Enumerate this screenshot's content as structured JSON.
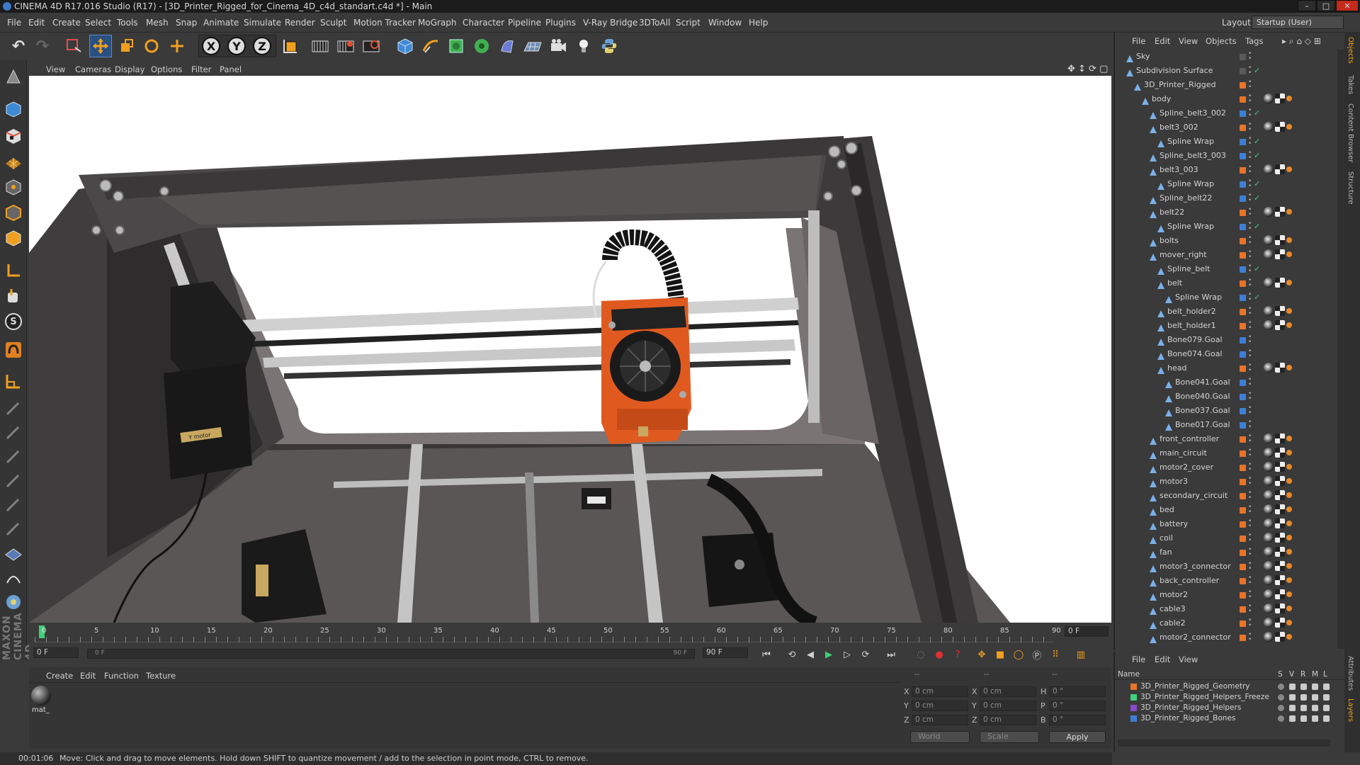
{
  "window": {
    "title": "CINEMA 4D R17.016 Studio (R17) - [3D_Printer_Rigged_for_Cinema_4D_c4d_standart.c4d *] - Main",
    "minimize": "–",
    "maximize": "□",
    "close": "✕"
  },
  "menu": [
    "File",
    "Edit",
    "Create",
    "Select",
    "Tools",
    "Mesh",
    "Snap",
    "Animate",
    "Simulate",
    "Render",
    "Sculpt",
    "Motion Tracker",
    "MoGraph",
    "Character",
    "Pipeline",
    "Plugins",
    "V-Ray Bridge",
    "3DToAll",
    "Script",
    "Window",
    "Help"
  ],
  "layout": {
    "label": "Layout:",
    "value": "Startup (User)"
  },
  "toolbar": {
    "x": "X",
    "y": "Y",
    "z": "Z"
  },
  "lefttools": {
    "s_label": "S"
  },
  "viewport": {
    "menu": [
      "View",
      "Cameras",
      "Display",
      "Options",
      "Filter",
      "Panel"
    ],
    "motor_label": "Y motor"
  },
  "timeline": {
    "ticks": [
      "0",
      "5",
      "10",
      "15",
      "20",
      "25",
      "30",
      "35",
      "40",
      "45",
      "50",
      "55",
      "60",
      "65",
      "70",
      "75",
      "80",
      "85",
      "90"
    ],
    "current_frame": "0 F",
    "start_field": "0 F",
    "range_start": "0 F",
    "range_end": "90 F",
    "end_field": "90 F"
  },
  "materials": {
    "menu": [
      "Create",
      "Edit",
      "Function",
      "Texture"
    ],
    "items": [
      {
        "name": "mat_"
      }
    ]
  },
  "coords": {
    "headers": [
      "--",
      "--",
      "--"
    ],
    "rows": [
      {
        "a": "X",
        "av": "0 cm",
        "b": "X",
        "bv": "0 cm",
        "c": "H",
        "cv": "0 °"
      },
      {
        "a": "Y",
        "av": "0 cm",
        "b": "Y",
        "bv": "0 cm",
        "c": "P",
        "cv": "0 °"
      },
      {
        "a": "Z",
        "av": "0 cm",
        "b": "Z",
        "bv": "0 cm",
        "c": "B",
        "cv": "0 °"
      }
    ],
    "space": "World",
    "mode": "Scale",
    "apply": "Apply"
  },
  "status": {
    "time": "00:01:06",
    "message": "Move: Click and drag to move elements. Hold down SHIFT to quantize movement / add to the selection in point mode, CTRL to remove."
  },
  "objects": {
    "menu": [
      "File",
      "Edit",
      "View",
      "Objects",
      "Tags"
    ],
    "items": [
      {
        "name": "Sky",
        "depth": 0,
        "color": "#5a5a5a",
        "tags": "",
        "check": ""
      },
      {
        "name": "Subdivision Surface",
        "depth": 0,
        "color": "#5a5a5a",
        "tags": "",
        "check": "✓"
      },
      {
        "name": "3D_Printer_Rigged",
        "depth": 1,
        "color": "#e8742a",
        "tags": "",
        "check": ""
      },
      {
        "name": "body",
        "depth": 2,
        "color": "#e8742a",
        "tags": "pco",
        "check": ""
      },
      {
        "name": "Spline_belt3_002",
        "depth": 3,
        "color": "#3d7fd6",
        "tags": "",
        "check": "✓"
      },
      {
        "name": "belt3_002",
        "depth": 3,
        "color": "#e8742a",
        "tags": "pco",
        "check": ""
      },
      {
        "name": "Spline Wrap",
        "depth": 4,
        "color": "#3d7fd6",
        "tags": "",
        "check": "✓"
      },
      {
        "name": "Spline_belt3_003",
        "depth": 3,
        "color": "#3d7fd6",
        "tags": "",
        "check": "✓"
      },
      {
        "name": "belt3_003",
        "depth": 3,
        "color": "#e8742a",
        "tags": "pco",
        "check": ""
      },
      {
        "name": "Spline Wrap",
        "depth": 4,
        "color": "#3d7fd6",
        "tags": "",
        "check": "✓"
      },
      {
        "name": "Spline_belt22",
        "depth": 3,
        "color": "#3d7fd6",
        "tags": "",
        "check": "✓"
      },
      {
        "name": "belt22",
        "depth": 3,
        "color": "#e8742a",
        "tags": "pco",
        "check": ""
      },
      {
        "name": "Spline Wrap",
        "depth": 4,
        "color": "#3d7fd6",
        "tags": "",
        "check": "✓"
      },
      {
        "name": "bolts",
        "depth": 3,
        "color": "#e8742a",
        "tags": "pco",
        "check": ""
      },
      {
        "name": "mover_right",
        "depth": 3,
        "color": "#e8742a",
        "tags": "pco",
        "check": ""
      },
      {
        "name": "Spline_belt",
        "depth": 4,
        "color": "#3d7fd6",
        "tags": "",
        "check": "✓"
      },
      {
        "name": "belt",
        "depth": 4,
        "color": "#e8742a",
        "tags": "pco",
        "check": ""
      },
      {
        "name": "Spline Wrap",
        "depth": 5,
        "color": "#3d7fd6",
        "tags": "",
        "check": "✓"
      },
      {
        "name": "belt_holder2",
        "depth": 4,
        "color": "#e8742a",
        "tags": "pco",
        "check": ""
      },
      {
        "name": "belt_holder1",
        "depth": 4,
        "color": "#e8742a",
        "tags": "pco",
        "check": ""
      },
      {
        "name": "Bone079.Goal",
        "depth": 4,
        "color": "#3d7fd6",
        "tags": "",
        "check": ""
      },
      {
        "name": "Bone074.Goal",
        "depth": 4,
        "color": "#3d7fd6",
        "tags": "",
        "check": ""
      },
      {
        "name": "head",
        "depth": 4,
        "color": "#e8742a",
        "tags": "pco",
        "check": ""
      },
      {
        "name": "Bone041.Goal",
        "depth": 5,
        "color": "#3d7fd6",
        "tags": "",
        "check": ""
      },
      {
        "name": "Bone040.Goal",
        "depth": 5,
        "color": "#3d7fd6",
        "tags": "",
        "check": ""
      },
      {
        "name": "Bone037.Goal",
        "depth": 5,
        "color": "#3d7fd6",
        "tags": "",
        "check": ""
      },
      {
        "name": "Bone017.Goal",
        "depth": 5,
        "color": "#3d7fd6",
        "tags": "",
        "check": ""
      },
      {
        "name": "front_controller",
        "depth": 3,
        "color": "#e8742a",
        "tags": "pco",
        "check": ""
      },
      {
        "name": "main_circuit",
        "depth": 3,
        "color": "#e8742a",
        "tags": "pco",
        "check": ""
      },
      {
        "name": "motor2_cover",
        "depth": 3,
        "color": "#e8742a",
        "tags": "pco",
        "check": ""
      },
      {
        "name": "motor3",
        "depth": 3,
        "color": "#e8742a",
        "tags": "pco",
        "check": ""
      },
      {
        "name": "secondary_circuit",
        "depth": 3,
        "color": "#e8742a",
        "tags": "pco",
        "check": ""
      },
      {
        "name": "bed",
        "depth": 3,
        "color": "#e8742a",
        "tags": "pco",
        "check": ""
      },
      {
        "name": "battery",
        "depth": 3,
        "color": "#e8742a",
        "tags": "pco",
        "check": ""
      },
      {
        "name": "coil",
        "depth": 3,
        "color": "#e8742a",
        "tags": "pco",
        "check": ""
      },
      {
        "name": "fan",
        "depth": 3,
        "color": "#e8742a",
        "tags": "pco",
        "check": ""
      },
      {
        "name": "motor3_connector",
        "depth": 3,
        "color": "#e8742a",
        "tags": "pco",
        "check": ""
      },
      {
        "name": "back_controller",
        "depth": 3,
        "color": "#e8742a",
        "tags": "pco",
        "check": ""
      },
      {
        "name": "motor2",
        "depth": 3,
        "color": "#e8742a",
        "tags": "pco",
        "check": ""
      },
      {
        "name": "cable3",
        "depth": 3,
        "color": "#e8742a",
        "tags": "pco",
        "check": ""
      },
      {
        "name": "cable2",
        "depth": 3,
        "color": "#e8742a",
        "tags": "pco",
        "check": ""
      },
      {
        "name": "motor2_connector",
        "depth": 3,
        "color": "#e8742a",
        "tags": "pco",
        "check": ""
      }
    ]
  },
  "layers": {
    "menu": [
      "File",
      "Edit",
      "View"
    ],
    "headers": {
      "name": "Name",
      "s": "S",
      "v": "V",
      "r": "R",
      "m": "M",
      "l": "L"
    },
    "items": [
      {
        "name": "3D_Printer_Rigged_Geometry",
        "color": "#e8742a"
      },
      {
        "name": "3D_Printer_Rigged_Helpers_Freeze",
        "color": "#3fd07a"
      },
      {
        "name": "3D_Printer_Rigged_Helpers",
        "color": "#8a4ac8"
      },
      {
        "name": "3D_Printer_Rigged_Bones",
        "color": "#3d7fd6"
      }
    ]
  },
  "sidetabs": [
    "Objects",
    "Takes",
    "Content Browser",
    "Structure",
    "Attributes",
    "Layers"
  ],
  "brand": "MAXON CINEMA 4D"
}
